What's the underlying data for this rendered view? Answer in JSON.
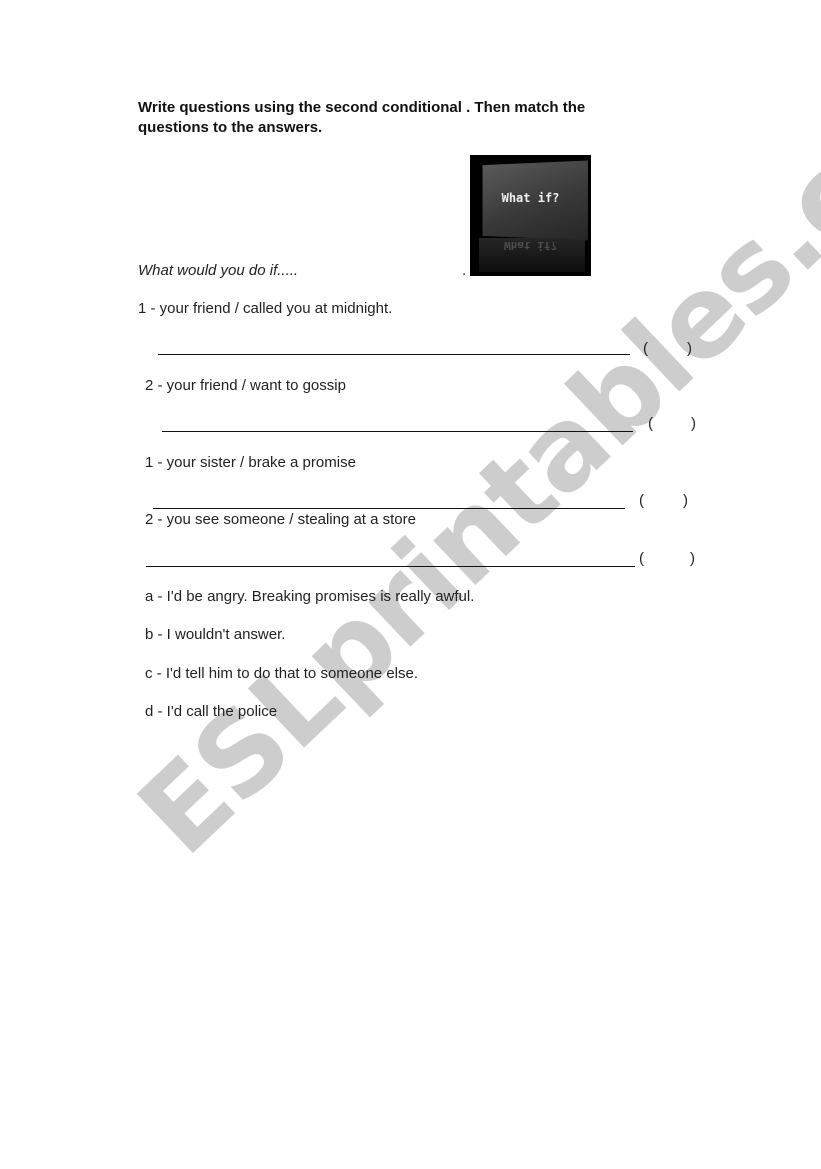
{
  "instructions": {
    "line1": "Write questions using the second conditional . Then match the",
    "line2": "questions to the answers."
  },
  "image": {
    "caption": "What if?",
    "reflection": "What if?"
  },
  "prompt": {
    "text": "What would you do if.....",
    "trailing_dot": "."
  },
  "questions": [
    {
      "text": "1 - your friend /  called you at midnight.",
      "blank": "",
      "open_paren": "(",
      "close_paren": ")"
    },
    {
      "text": "2 - your friend / want to gossip",
      "blank": "",
      "open_paren": "(",
      "close_paren": ")"
    },
    {
      "text": "1   -  your sister / brake a promise",
      "blank": "",
      "open_paren": "(",
      "close_paren": ")"
    },
    {
      "text": "2   -  you see someone /  stealing at a store",
      "blank": "",
      "open_paren": "(",
      "close_paren": ")"
    }
  ],
  "answers": [
    {
      "text": "a -  I'd be angry. Breaking promises is really awful."
    },
    {
      "text": "b -  I wouldn't answer."
    },
    {
      "text": "c -  I'd tell him to do that to someone else."
    },
    {
      "text": "d -  I'd call the police"
    }
  ],
  "watermark": {
    "text": "ESLprintables.com",
    "color": "#c9c9c9"
  }
}
